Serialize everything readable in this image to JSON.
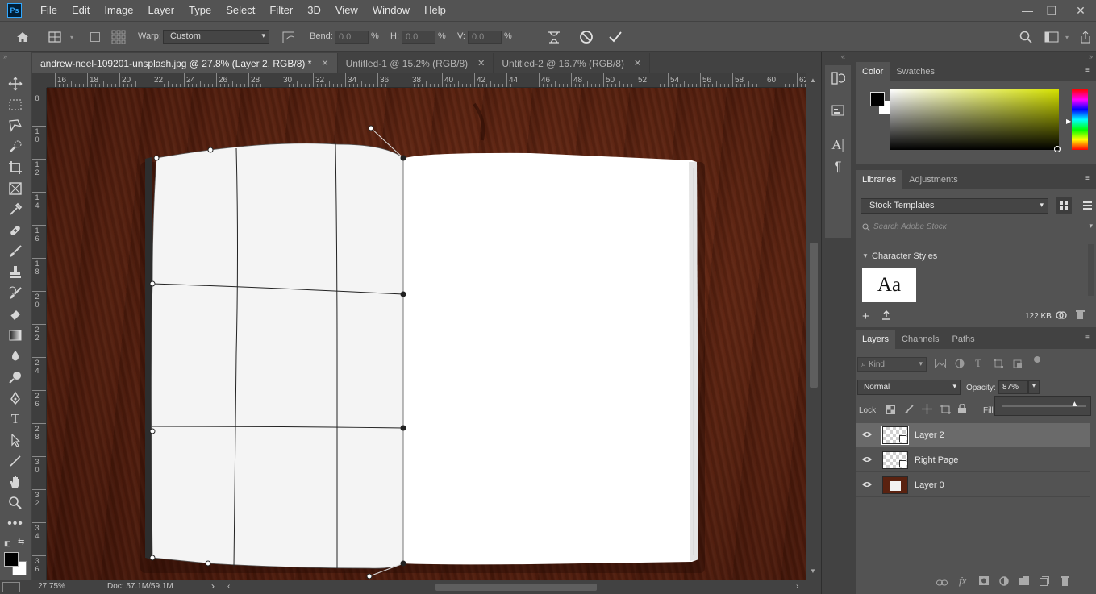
{
  "app": {
    "logo_text": "Ps",
    "menu": [
      "File",
      "Edit",
      "Image",
      "Layer",
      "Type",
      "Select",
      "Filter",
      "3D",
      "View",
      "Window",
      "Help"
    ],
    "window_controls": {
      "minimize": "—",
      "restore": "❐",
      "close": "✕"
    }
  },
  "options_bar": {
    "warp_label": "Warp:",
    "warp_value": "Custom",
    "bend_label": "Bend:",
    "bend_value": "0.0",
    "bend_unit": "%",
    "h_label": "H:",
    "h_value": "0.0",
    "h_unit": "%",
    "v_label": "V:",
    "v_value": "0.0",
    "v_unit": "%",
    "cancel_icon": "⃠",
    "commit_icon": "✓"
  },
  "tabs": [
    {
      "label": "andrew-neel-109201-unsplash.jpg @ 27.8% (Layer 2, RGB/8) *",
      "close": "✕",
      "active": true
    },
    {
      "label": "Untitled-1 @ 15.2% (RGB/8)",
      "close": "✕",
      "active": false
    },
    {
      "label": "Untitled-2 @ 16.7% (RGB/8)",
      "close": "✕",
      "active": false
    }
  ],
  "ruler": {
    "top_labels": [
      "16",
      "18",
      "20",
      "22",
      "24",
      "26",
      "28",
      "30",
      "32",
      "34",
      "36",
      "38",
      "40",
      "42",
      "44",
      "46",
      "48",
      "50",
      "52",
      "54",
      "56",
      "58",
      "60",
      "62"
    ],
    "left_labels": [
      "8",
      "10",
      "12",
      "14",
      "16",
      "18",
      "20",
      "22",
      "24",
      "26",
      "28",
      "30",
      "32",
      "34",
      "36"
    ]
  },
  "status": {
    "zoom": "27.75%",
    "doc": "Doc: 57.1M/59.1M",
    "arrow": "›"
  },
  "color_panel": {
    "tabs": [
      "Color",
      "Swatches"
    ],
    "foreground": "#000000",
    "background": "#ffffff",
    "hue_color": "#d4e000"
  },
  "libraries_panel": {
    "tabs": [
      "Libraries",
      "Adjustments"
    ],
    "library_select": "Stock Templates",
    "search_placeholder": "Search Adobe Stock",
    "section_title": "Character Styles",
    "char_style_preview": "Aa",
    "size": "122 KB"
  },
  "layers_panel": {
    "tabs": [
      "Layers",
      "Channels",
      "Paths"
    ],
    "filter_kind": "Kind",
    "blend_mode": "Normal",
    "opacity_label": "Opacity:",
    "opacity_value": "87%",
    "opacity_level": 0.87,
    "lock_label": "Lock:",
    "fill_label": "Fill",
    "layers": [
      {
        "name": "Layer 2",
        "selected": true,
        "thumb": "checker"
      },
      {
        "name": "Right Page",
        "selected": false,
        "thumb": "checker"
      },
      {
        "name": "Layer 0",
        "selected": false,
        "thumb": "photo"
      }
    ]
  }
}
